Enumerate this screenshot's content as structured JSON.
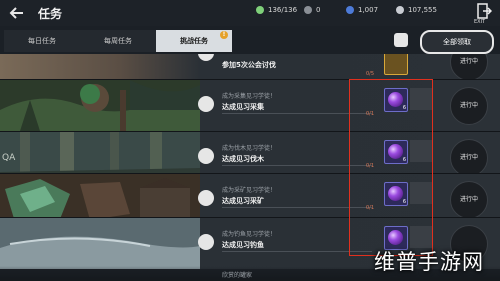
{
  "header": {
    "title": "任务",
    "resources": [
      {
        "value": "136/136",
        "icon": "stamina-icon",
        "color": "#7fd07a"
      },
      {
        "value": "0",
        "icon": "coin-icon",
        "color": "#8a8f96"
      },
      {
        "value": "1,007",
        "icon": "gem-icon",
        "color": "#4d7bd8"
      },
      {
        "value": "107,555",
        "icon": "silver-icon",
        "color": "#c8ccd2"
      }
    ],
    "exit_label": "EXIT"
  },
  "tabs": [
    {
      "label": "每日任务",
      "active": false
    },
    {
      "label": "每周任务",
      "active": false
    },
    {
      "label": "挑战任务",
      "active": true,
      "badge": "!"
    }
  ],
  "claim_all_label": "全部领取",
  "tasks": [
    {
      "subtitle": "",
      "name": "参加5次公会讨伐",
      "progress": "0/5",
      "status": "进行中",
      "reward_count": "",
      "icon": "guild-icon"
    },
    {
      "subtitle": "成为采集见习学徒！",
      "name": "达成见习采集",
      "progress": "0/1",
      "status": "进行中",
      "reward_count": "6",
      "icon": "gather-icon"
    },
    {
      "subtitle": "成为伐木见习学徒！",
      "name": "达成见习伐木",
      "progress": "0/1",
      "status": "进行中",
      "reward_count": "6",
      "icon": "axe-icon"
    },
    {
      "subtitle": "成为采矿见习学徒！",
      "name": "达成见习采矿",
      "progress": "0/1",
      "status": "进行中",
      "reward_count": "6",
      "icon": "pickaxe-icon"
    },
    {
      "subtitle": "成为钓鱼见习学徒！",
      "name": "达成见习钓鱼",
      "progress": "0/1",
      "status": "",
      "reward_count": "",
      "icon": "fishing-icon"
    }
  ],
  "next_task_name": "欣赏的罐家",
  "watermark": "维普手游网",
  "colors": {
    "highlight": "#e0301e",
    "accent": "#e5a12a",
    "progress": "#d87a5a"
  }
}
